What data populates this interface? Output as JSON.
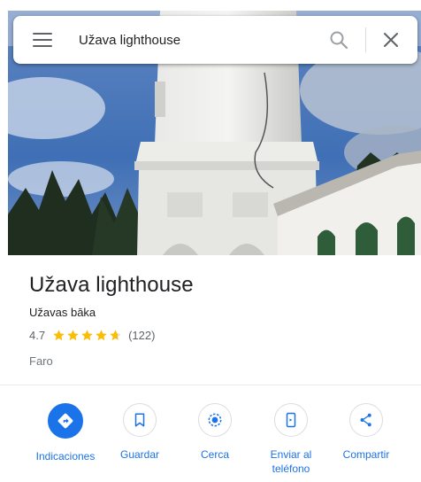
{
  "search": {
    "query": "Užava lighthouse",
    "icons": [
      "menu-icon",
      "search-icon",
      "close-icon"
    ]
  },
  "place": {
    "title": "Užava lighthouse",
    "local_name": "Užavas bāka",
    "rating": "4.7",
    "rating_fraction": 0.94,
    "review_count": "(122)",
    "category": "Faro"
  },
  "actions": [
    {
      "label": "Indicaciones",
      "icon": "directions-icon"
    },
    {
      "label": "Guardar",
      "icon": "bookmark-icon"
    },
    {
      "label": "Cerca",
      "icon": "nearby-icon"
    },
    {
      "label": "Enviar al\nteléfono",
      "icon": "send-to-phone-icon"
    },
    {
      "label": "Compartir",
      "icon": "share-icon"
    }
  ],
  "colors": {
    "accent": "#1a73e8",
    "star": "#fbbc04",
    "text": "#202124",
    "secondary": "#70757a"
  }
}
